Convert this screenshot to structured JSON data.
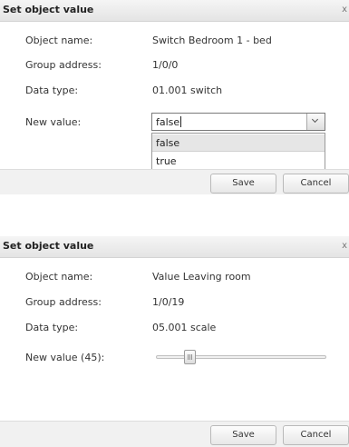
{
  "dialogs": [
    {
      "title": "Set object value",
      "close_glyph": "x",
      "fields": [
        {
          "label": "Object name:",
          "value": "Switch Bedroom 1 - bed"
        },
        {
          "label": "Group address:",
          "value": "1/0/0"
        },
        {
          "label": "Data type:",
          "value": "01.001 switch"
        }
      ],
      "new_value_label": "New value:",
      "select": {
        "current_value": "false",
        "options": [
          "false",
          "true"
        ],
        "selected_option": "false"
      },
      "buttons": {
        "save": "Save",
        "cancel": "Cancel"
      }
    },
    {
      "title": "Set object value",
      "close_glyph": "x",
      "fields": [
        {
          "label": "Object name:",
          "value": "Value Leaving room"
        },
        {
          "label": "Group address:",
          "value": "1/0/19"
        },
        {
          "label": "Data type:",
          "value": "05.001 scale"
        }
      ],
      "new_value_label": "New value (45):",
      "slider": {
        "value": 45,
        "min": 0,
        "max": 255
      },
      "buttons": {
        "save": "Save",
        "cancel": "Cancel"
      }
    }
  ],
  "colors": {
    "titlebar": "#e8e8e8",
    "footer": "#f1f1f1",
    "text": "#333333"
  }
}
